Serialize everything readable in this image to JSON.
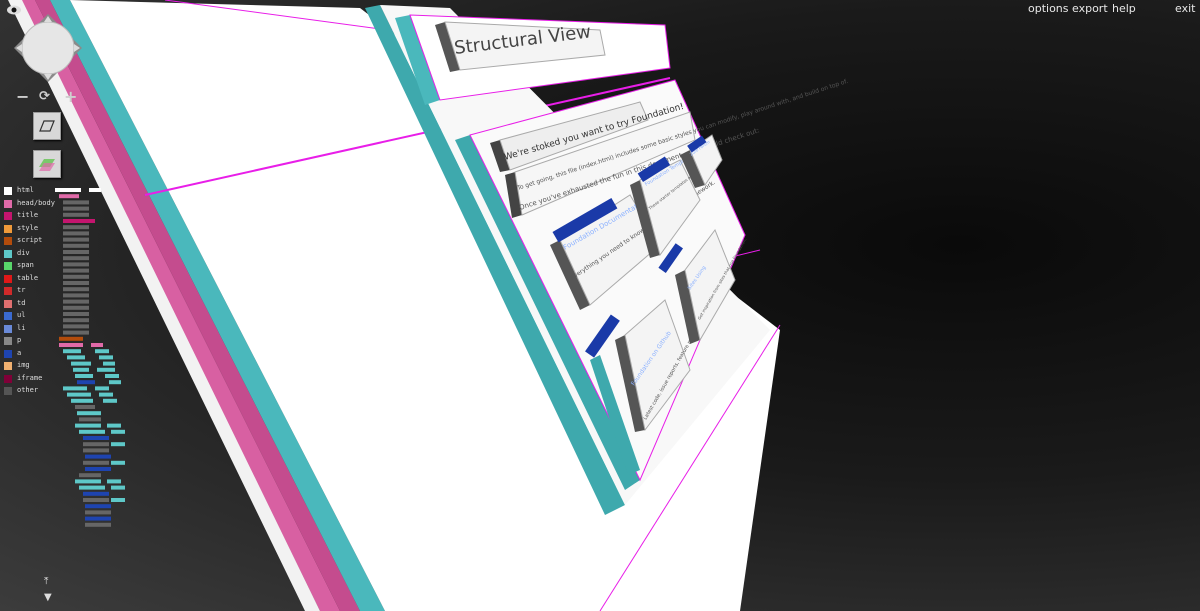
{
  "menu": {
    "options": "options",
    "export": "export",
    "help": "help",
    "exit": "exit"
  },
  "controls": {
    "zoom_out": "−",
    "reset": "⟳",
    "zoom_in": "+"
  },
  "legend": [
    {
      "label": "html",
      "color": "#ffffff"
    },
    {
      "label": "head/body",
      "color": "#e06aa8"
    },
    {
      "label": "title",
      "color": "#c4156e"
    },
    {
      "label": "style",
      "color": "#f09a3a"
    },
    {
      "label": "script",
      "color": "#b34c0c"
    },
    {
      "label": "div",
      "color": "#5ec8c8"
    },
    {
      "label": "span",
      "color": "#58d66a"
    },
    {
      "label": "table",
      "color": "#e01818"
    },
    {
      "label": "tr",
      "color": "#d02a2a"
    },
    {
      "label": "td",
      "color": "#e07070"
    },
    {
      "label": "ul",
      "color": "#3a6ad0"
    },
    {
      "label": "li",
      "color": "#6a8ad8"
    },
    {
      "label": "p",
      "color": "#888888"
    },
    {
      "label": "a",
      "color": "#1e44b0"
    },
    {
      "label": "img",
      "color": "#f0b070"
    },
    {
      "label": "iframe",
      "color": "#800038"
    },
    {
      "label": "other",
      "color": "#555555"
    }
  ],
  "page": {
    "header_title": "Structural View",
    "heading": "We're stoked you want to try Foundation!",
    "intro": "To get going, this file (index.html) includes some basic styles you can modify, play around with, and build on top of.",
    "intro2": "Once you've exhausted the fun in this document, you should check out:",
    "card1_title": "Foundation Documentation",
    "card1_text": "Everything you need to know about using the framework.",
    "card2_title": "Foundation Templates",
    "card2_text": "These starter templates are ready to use.",
    "card3_title": "Foundation on Github",
    "card3_text": "Latest code, issue reports, feature requests and more.",
    "card4_title": "Zurb Forum",
    "card4_text": "Join the discussion.",
    "card5_title": "Sites Using",
    "card5_text": "Get inspiration from sites that use Foundation."
  }
}
